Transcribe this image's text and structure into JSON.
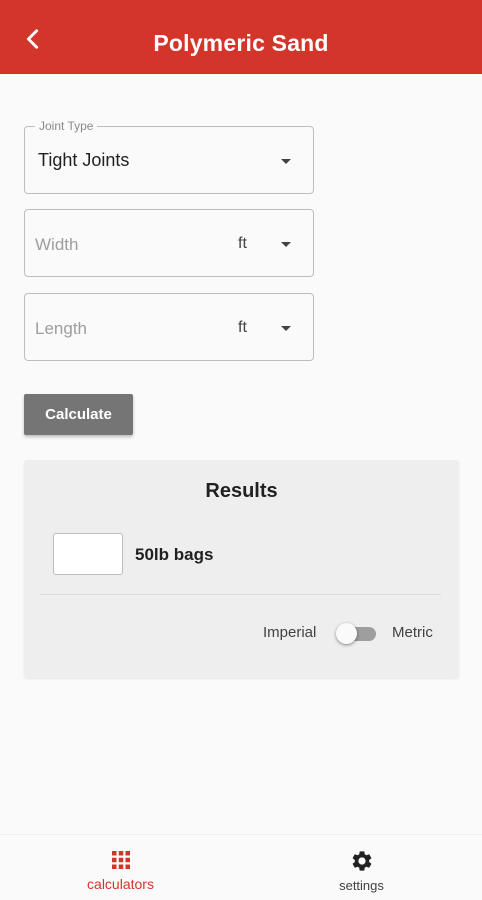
{
  "colors": {
    "accent": "#d4352b",
    "button": "#757575",
    "card": "#eeeeee",
    "background": "#fafafa"
  },
  "header": {
    "title": "Polymeric Sand",
    "back_icon": "chevron-left-icon"
  },
  "form": {
    "joint_type": {
      "legend": "Joint Type",
      "value": "Tight Joints"
    },
    "width": {
      "placeholder": "Width",
      "unit": "ft"
    },
    "length": {
      "placeholder": "Length",
      "unit": "ft"
    },
    "calculate_label": "Calculate"
  },
  "results": {
    "title": "Results",
    "value": "",
    "unit_label": "50lb bags",
    "toggle": {
      "left_label": "Imperial",
      "right_label": "Metric",
      "state": "Imperial"
    }
  },
  "bottom_nav": {
    "items": [
      {
        "label": "calculators",
        "icon": "grid-icon",
        "active": true
      },
      {
        "label": "settings",
        "icon": "gear-icon",
        "active": false
      }
    ]
  }
}
